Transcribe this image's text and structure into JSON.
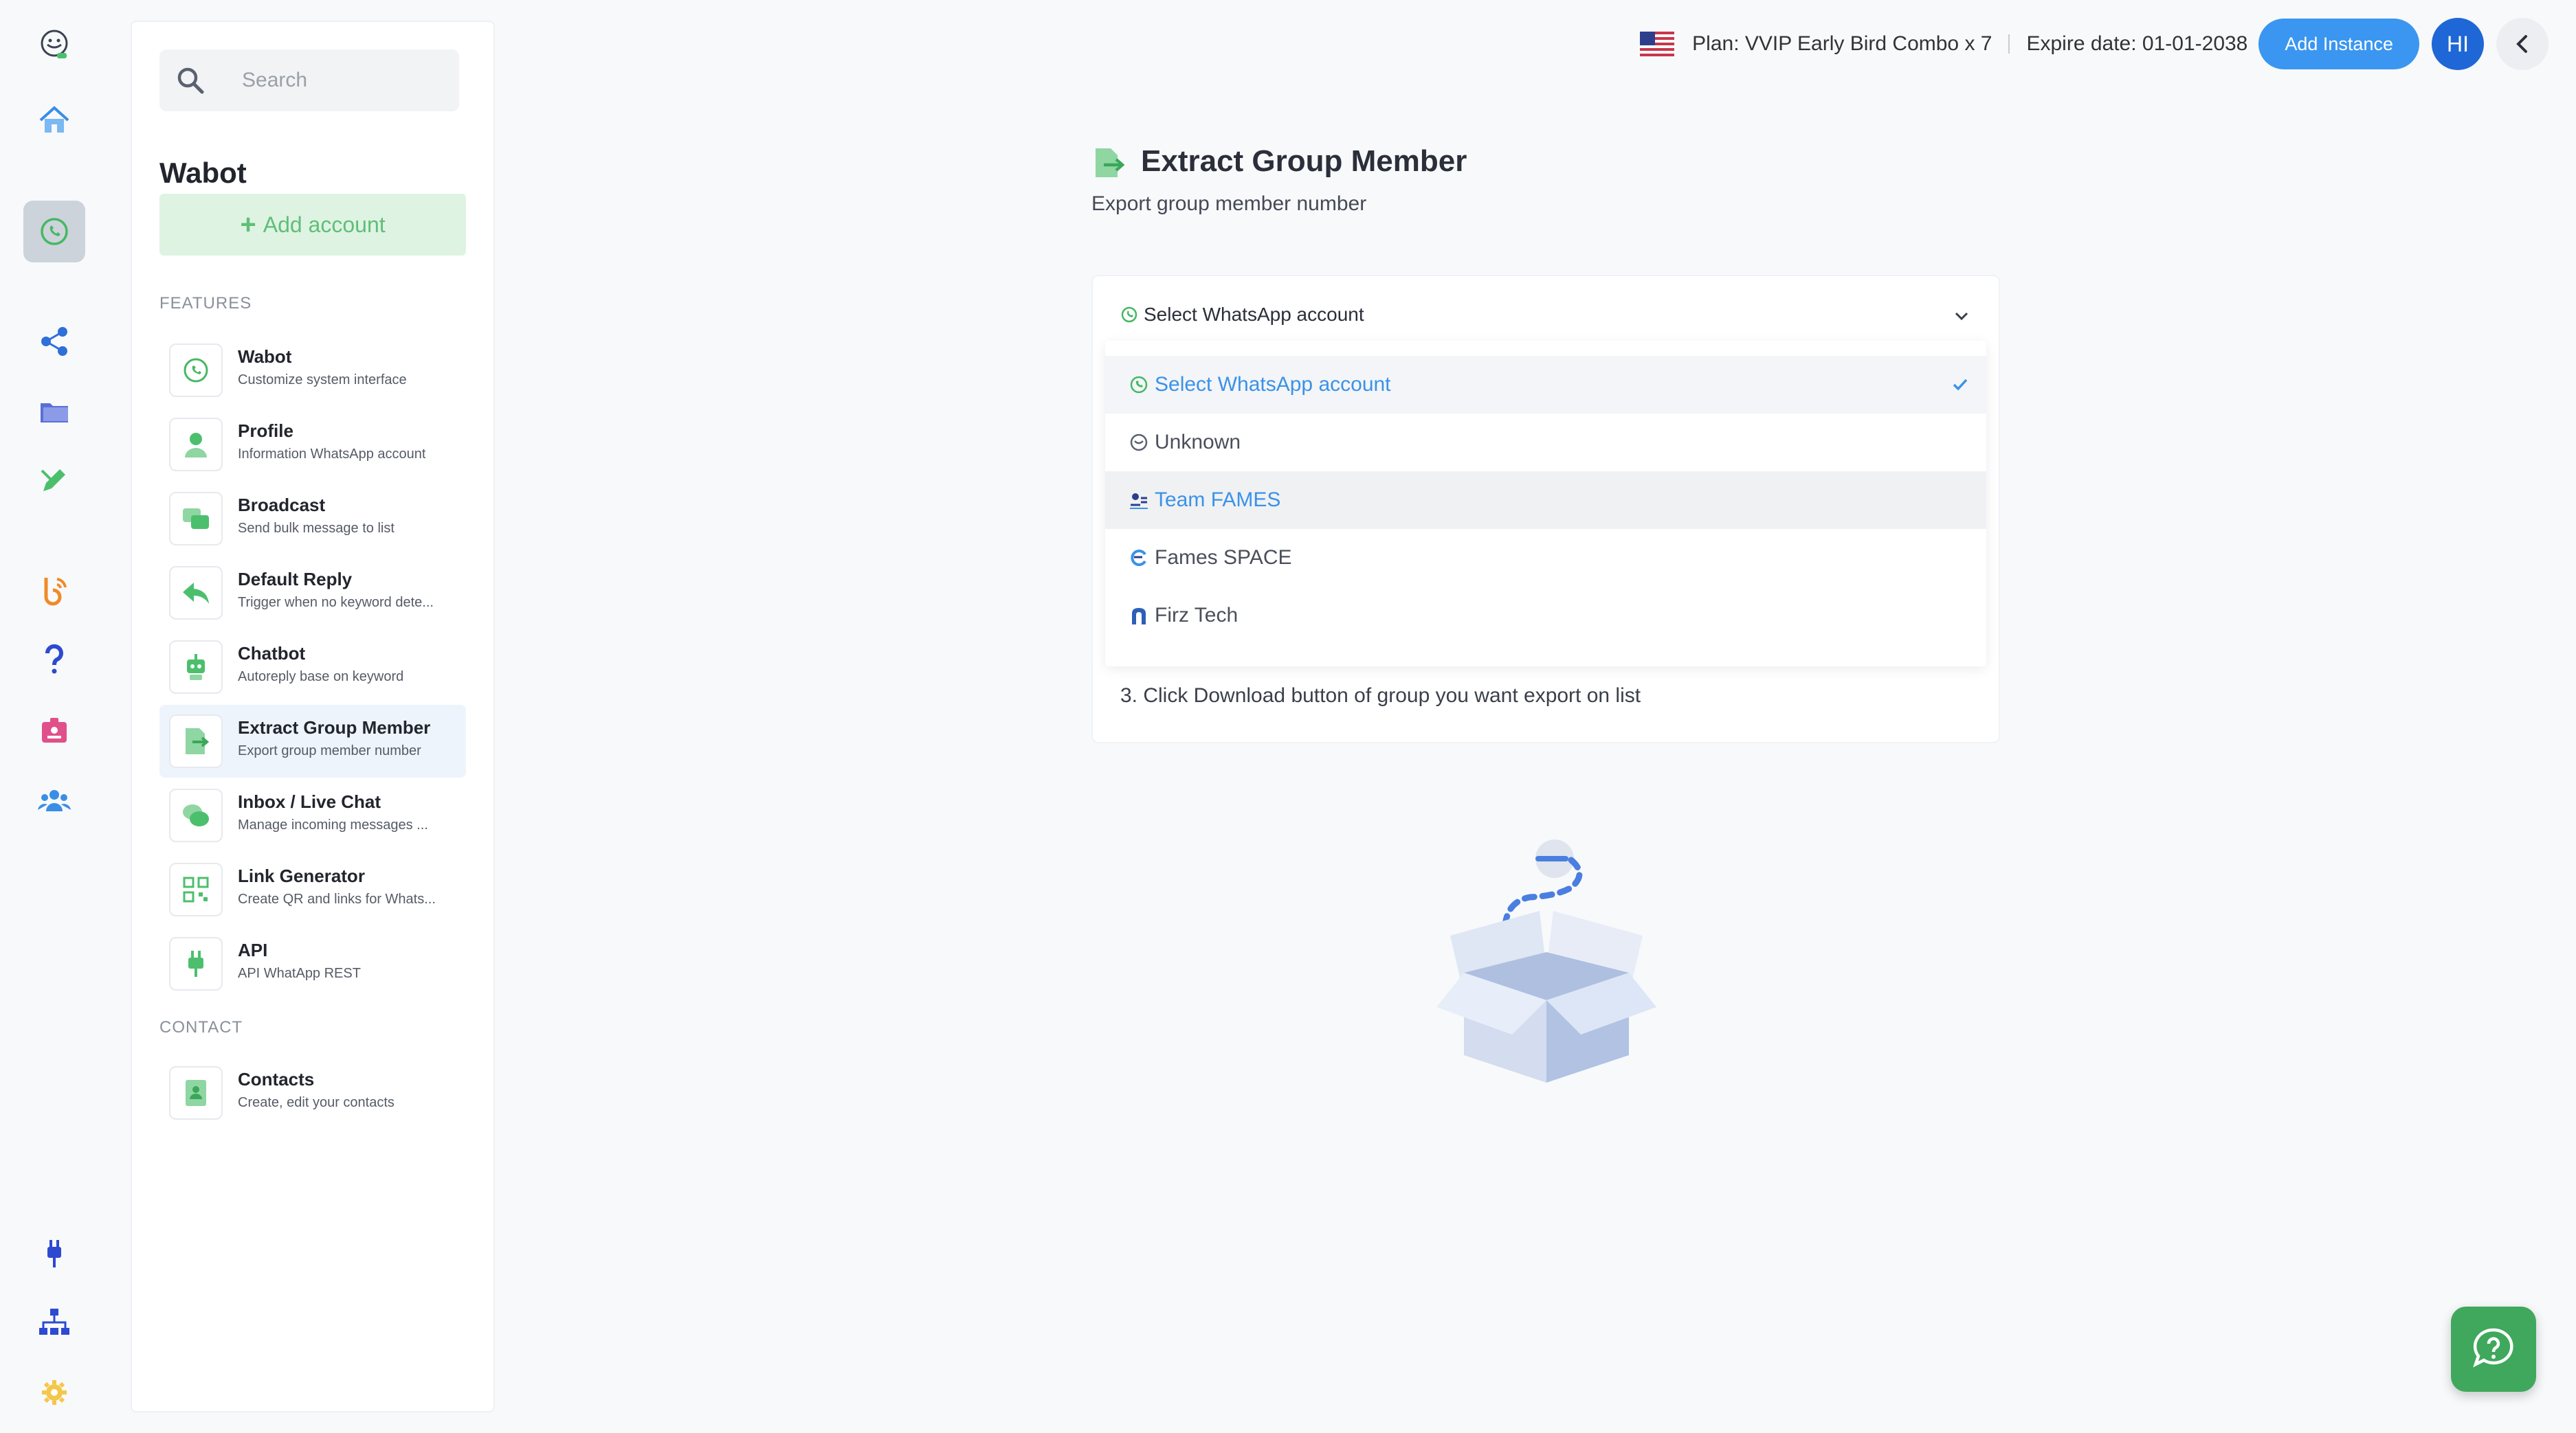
{
  "rail": {
    "items": [
      {
        "name": "logo-icon"
      },
      {
        "name": "home-icon"
      },
      {
        "name": "whatsapp-icon"
      },
      {
        "name": "share-icon"
      },
      {
        "name": "folder-icon"
      },
      {
        "name": "pencil-icon"
      },
      {
        "name": "blog-icon"
      },
      {
        "name": "help-icon"
      },
      {
        "name": "id-card-icon"
      },
      {
        "name": "users-icon"
      },
      {
        "name": "plug-icon"
      },
      {
        "name": "sitemap-icon"
      },
      {
        "name": "gear-icon"
      }
    ]
  },
  "sidebar": {
    "search_placeholder": "Search",
    "title": "Wabot",
    "add_account_label": "Add account",
    "features_label": "FEATURES",
    "contact_label": "CONTACT",
    "features": [
      {
        "title": "Wabot",
        "desc": "Customize system interface",
        "icon": "whatsapp-icon"
      },
      {
        "title": "Profile",
        "desc": "Information WhatsApp account",
        "icon": "user-icon"
      },
      {
        "title": "Broadcast",
        "desc": "Send bulk message to list",
        "icon": "broadcast-icon"
      },
      {
        "title": "Default Reply",
        "desc": "Trigger when no keyword dete...",
        "icon": "reply-icon"
      },
      {
        "title": "Chatbot",
        "desc": "Autoreply base on keyword",
        "icon": "robot-icon"
      },
      {
        "title": "Extract Group Member",
        "desc": "Export group member number",
        "icon": "export-icon"
      },
      {
        "title": "Inbox / Live Chat",
        "desc": "Manage incoming messages ...",
        "icon": "chat-icon"
      },
      {
        "title": "Link Generator",
        "desc": "Create QR and links for Whats...",
        "icon": "qr-icon"
      },
      {
        "title": "API",
        "desc": "API WhatApp REST",
        "icon": "plug-icon"
      }
    ],
    "contacts": [
      {
        "title": "Contacts",
        "desc": "Create, edit your contacts",
        "icon": "contacts-icon"
      }
    ]
  },
  "topbar": {
    "plan": "Plan: VVIP Early Bird Combo x 7",
    "expire": "Expire date: 01-01-2038",
    "add_instance_label": "Add Instance",
    "avatar_initials": "HI"
  },
  "main": {
    "title": "Extract Group Member",
    "subtitle": "Export group member number",
    "select_value": "Select WhatsApp account",
    "instruction_3": "3. Click Download button of group you want export on list",
    "dropdown_options": [
      {
        "label": "Select WhatsApp account",
        "state": "selected"
      },
      {
        "label": "Unknown",
        "state": "normal"
      },
      {
        "label": "Team FAMES",
        "state": "hovered"
      },
      {
        "label": "Fames SPACE",
        "state": "normal"
      },
      {
        "label": "Firz Tech",
        "state": "normal"
      }
    ]
  },
  "colors": {
    "accent": "#3a96f0",
    "green": "#5fbf78",
    "avatar": "#1f67d6"
  }
}
